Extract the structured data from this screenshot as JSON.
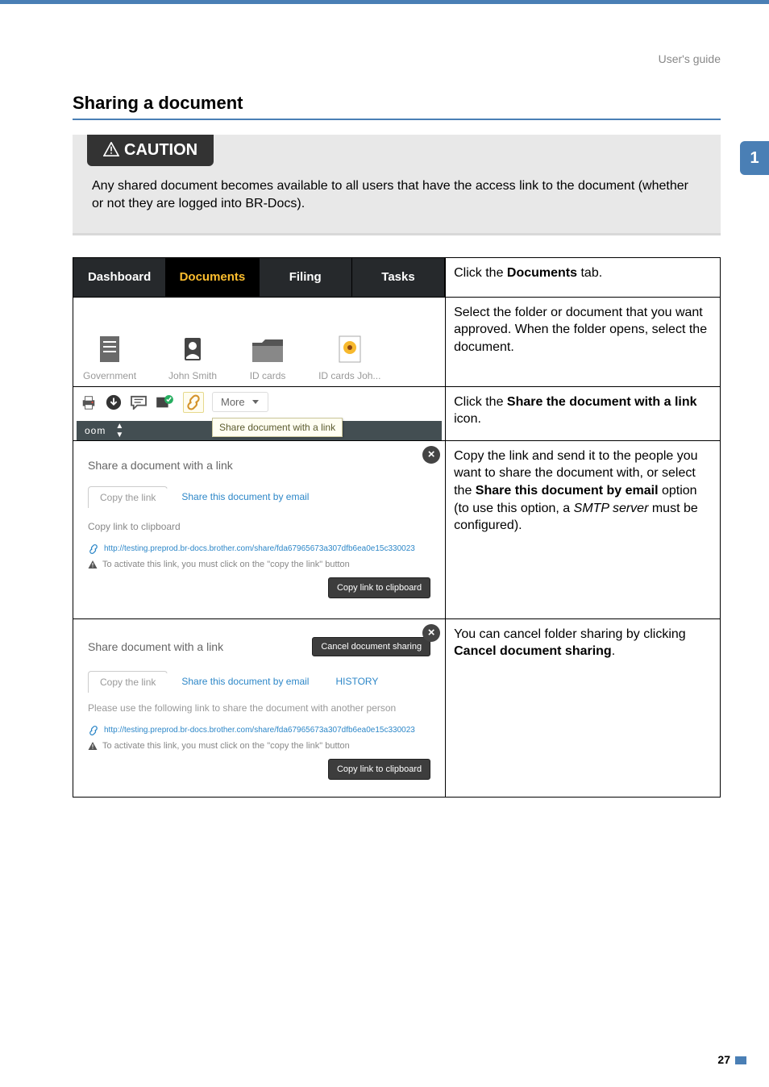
{
  "header": {
    "guide_label": "User's guide"
  },
  "side_tab": {
    "number": "1"
  },
  "section": {
    "title": "Sharing a document"
  },
  "caution": {
    "label": "CAUTION",
    "body": "Any shared document becomes available to all users that have the access link to the document (whether or not they are logged into BR-Docs)."
  },
  "row1": {
    "tabs": {
      "dashboard": "Dashboard",
      "documents": "Documents",
      "filing": "Filing",
      "tasks": "Tasks"
    },
    "desc_prefix": "Click the ",
    "desc_bold": "Documents",
    "desc_suffix": " tab."
  },
  "row2": {
    "items": {
      "government": "Government",
      "john": "John Smith",
      "idcards": "ID cards",
      "idcardsjoh": "ID cards Joh..."
    },
    "desc": "Select the folder or document that you want approved. When the folder opens, select the document."
  },
  "row3": {
    "more": "More",
    "zoom": "oom",
    "tooltip": "Share document with a link",
    "desc_prefix": "Click the ",
    "desc_bold": "Share the document with a link",
    "desc_suffix": " icon."
  },
  "row4": {
    "title": "Share a document with a link",
    "tab_copy": "Copy the link",
    "tab_email": "Share this document by email",
    "sub": "Copy link to clipboard",
    "url": "http://testing.preprod.br-docs.brother.com/share/fda67965673a307dfb6ea0e15c330023",
    "warn": "To activate this link, you must click on the \"copy the link\" button",
    "copy_btn": "Copy link to clipboard",
    "desc_p1a": "Copy the link and send it to the people you want to share the document with, or select the ",
    "desc_p1b": "Share this document by email",
    "desc_p1c": " option (to use this option, a ",
    "desc_p1d": "SMTP server",
    "desc_p1e": " must be configured)."
  },
  "row5": {
    "title": "Share document with a link",
    "cancel": "Cancel document sharing",
    "tab_copy": "Copy the link",
    "tab_email": "Share this document by email",
    "tab_history": "HISTORY",
    "instruction": "Please use the following link to share the document with another person",
    "url": "http://testing.preprod.br-docs.brother.com/share/fda67965673a307dfb6ea0e15c330023",
    "warn": "To activate this link, you must click on the \"copy the link\" button",
    "copy_btn": "Copy link to clipboard",
    "desc_a": "You can cancel folder sharing by clicking ",
    "desc_b": "Cancel document sharing",
    "desc_c": "."
  },
  "footer": {
    "page": "27"
  }
}
